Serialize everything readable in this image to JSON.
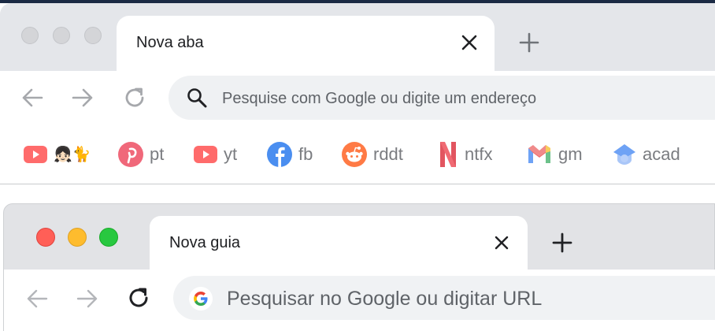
{
  "window1": {
    "tab": {
      "title": "Nova aba"
    },
    "omnibox": {
      "placeholder": "Pesquise com Google ou digite um endereço"
    },
    "bookmarks": [
      {
        "label": "👧🏻🐈",
        "icon": "youtube-icon"
      },
      {
        "label": "pt",
        "icon": "pinterest-icon"
      },
      {
        "label": "yt",
        "icon": "youtube-icon"
      },
      {
        "label": "fb",
        "icon": "facebook-icon"
      },
      {
        "label": "rddt",
        "icon": "reddit-icon"
      },
      {
        "label": "ntfx",
        "icon": "netflix-icon"
      },
      {
        "label": "gm",
        "icon": "gmail-icon"
      },
      {
        "label": "acad",
        "icon": "google-classroom-icon"
      }
    ]
  },
  "window2": {
    "tab": {
      "title": "Nova guia"
    },
    "omnibox": {
      "placeholder": "Pesquisar no Google ou digitar URL"
    }
  },
  "colors": {
    "youtube": "#ff4e45",
    "pinterest": "#e60023",
    "facebook": "#1877f2",
    "reddit": "#ff4500",
    "netflix": "#e50914",
    "mac_close": "#ff5f57",
    "mac_minimize": "#febc2e",
    "mac_zoom": "#28c840"
  }
}
